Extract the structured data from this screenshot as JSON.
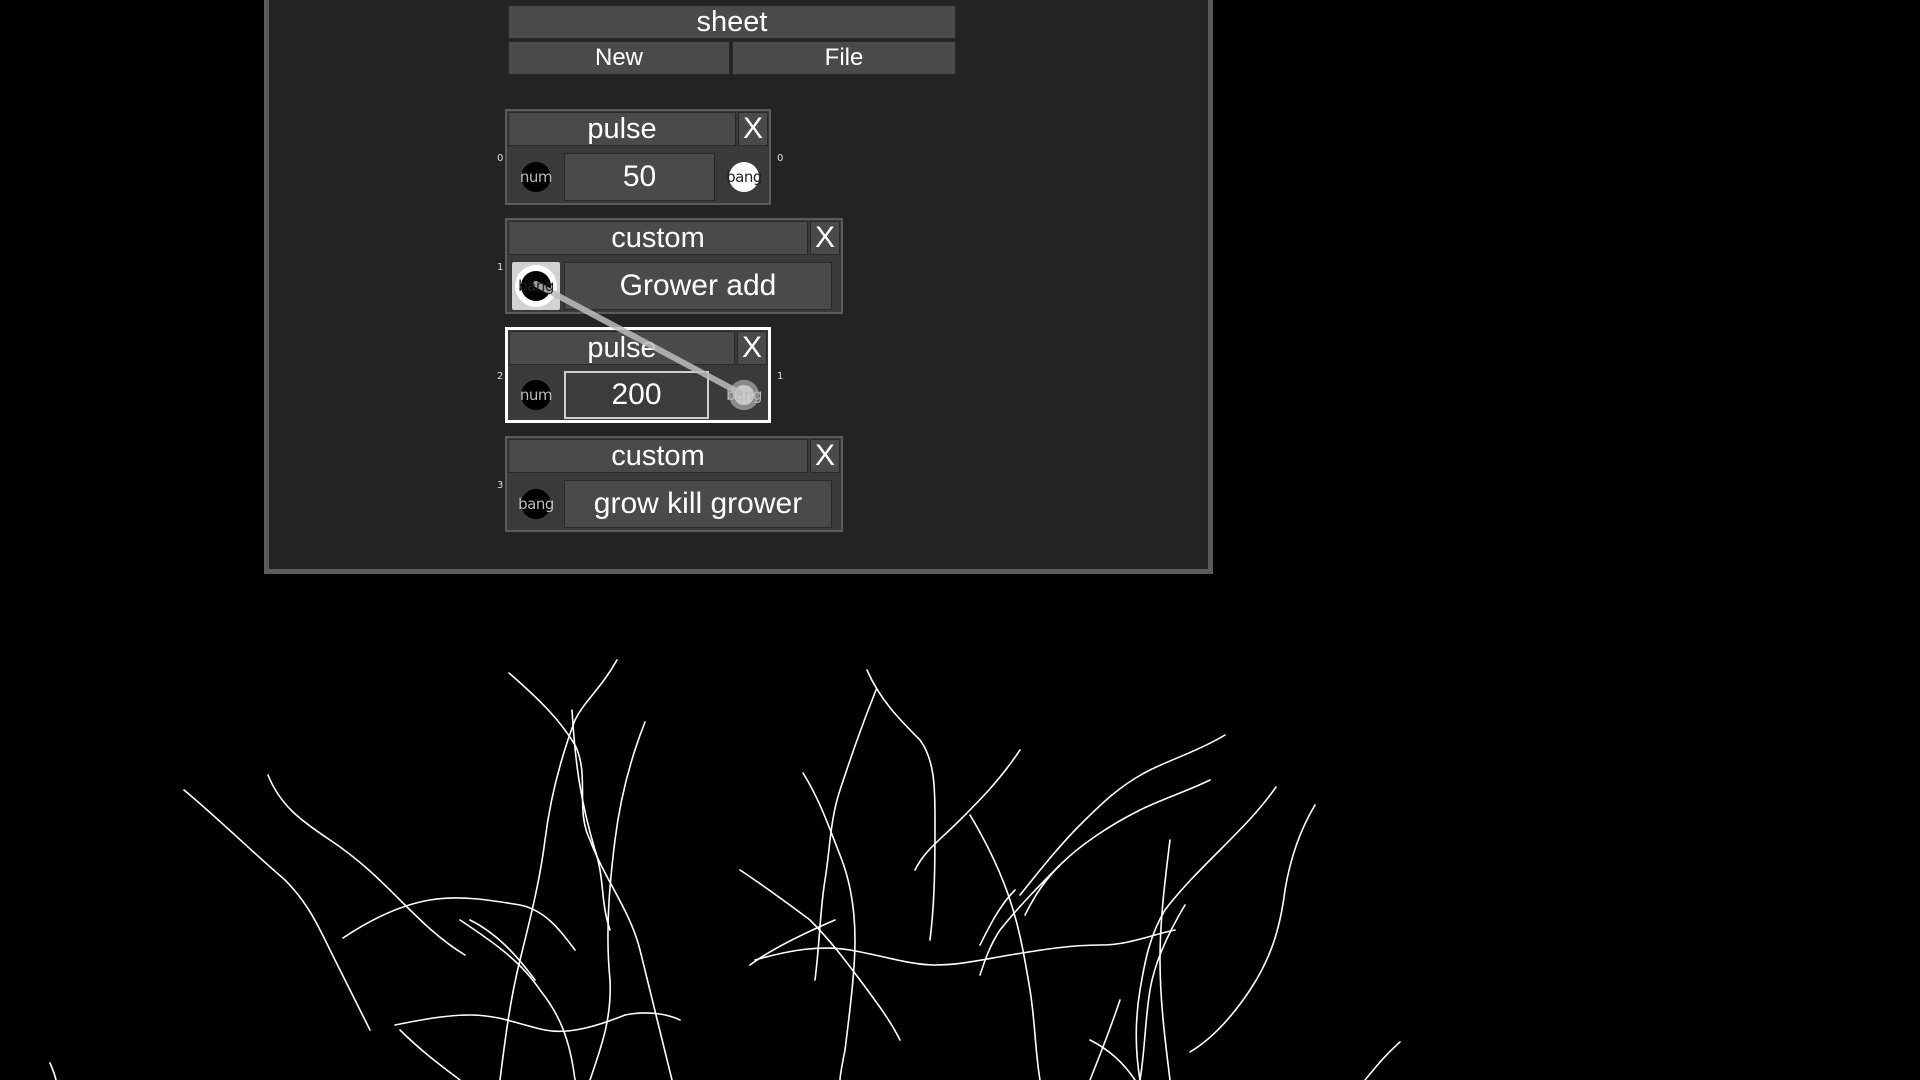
{
  "sheet": {
    "title": "sheet",
    "new_label": "New",
    "file_label": "File"
  },
  "nodes": [
    {
      "title": "pulse",
      "close": "X",
      "value": "50",
      "in_port": "num",
      "out_port": "bang",
      "in_index": "0",
      "out_index": "0"
    },
    {
      "title": "custom",
      "close": "X",
      "value": "Grower add",
      "in_port": "bang",
      "in_index": "1"
    },
    {
      "title": "pulse",
      "close": "X",
      "value": "200",
      "in_port": "num",
      "out_port": "bang",
      "in_index": "2",
      "out_index": "1"
    },
    {
      "title": "custom",
      "close": "X",
      "value": "grow kill grower",
      "in_port": "bang",
      "in_index": "3"
    }
  ],
  "colors": {
    "background": "#000000",
    "panel": "#232323",
    "panel_border": "#5b5b5b",
    "widget": "#4a4a4a",
    "selected_border": "#ffffff",
    "roots": "#ffffff",
    "wire": "#bdbdbd"
  }
}
